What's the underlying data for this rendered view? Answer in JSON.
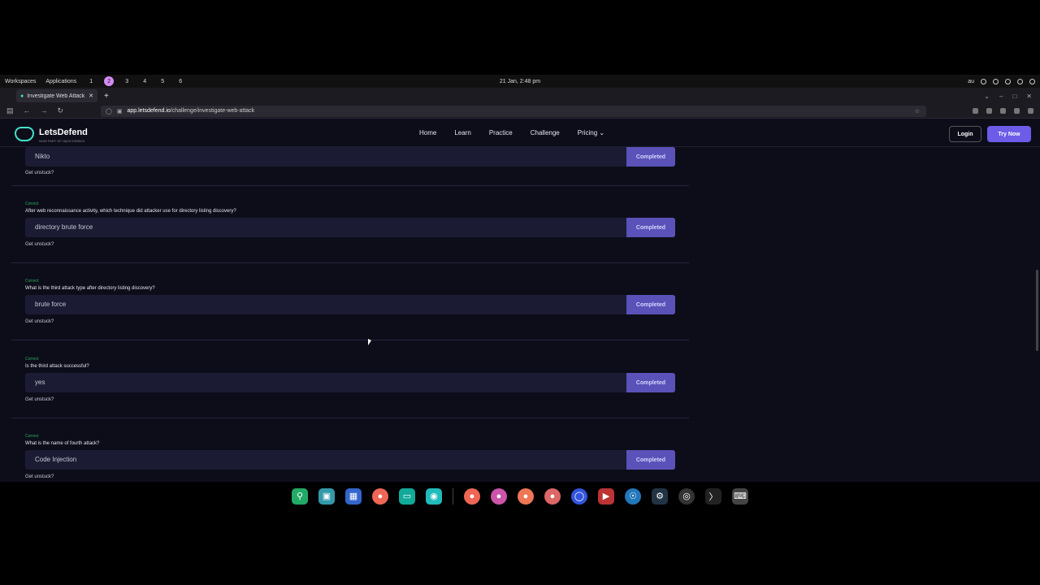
{
  "system_bar": {
    "workspaces_label": "Workspaces",
    "applications_label": "Applications",
    "workspace_numbers": [
      "1",
      "2",
      "3",
      "4",
      "5",
      "6"
    ],
    "active_workspace": "2",
    "clock": "21 Jan, 2:48 pm",
    "keyboard_layout": "au"
  },
  "browser": {
    "tab_title": "Investigate Web Attack - L",
    "url_host": "app.letsdefend.io",
    "url_path": "/challenge/investigate-web-attack"
  },
  "site": {
    "brand": "LetsDefend",
    "brand_sub": "NOW PART OF HACKTHEBOX",
    "brand_color": "#45e0c8",
    "nav": [
      "Home",
      "Learn",
      "Practice",
      "Challenge",
      "Pricing"
    ],
    "login_label": "Login",
    "try_label": "Try Now",
    "accent": "#6c5ce7"
  },
  "questions": [
    {
      "status": "",
      "question": "",
      "answer": "Nikto",
      "button": "Completed",
      "unstuck": "Get unstuck?"
    },
    {
      "status": "Correct",
      "question": "After web reconnaissance activity, which technique did attacker use for directory listing discovery?",
      "answer": "directory brute force",
      "button": "Completed",
      "unstuck": "Get unstuck?"
    },
    {
      "status": "Correct",
      "question": "What is the third attack type after directory listing discovery?",
      "answer": "brute force",
      "button": "Completed",
      "unstuck": "Get unstuck?"
    },
    {
      "status": "Correct",
      "question": "Is the third attack successful?",
      "answer": "yes",
      "button": "Completed",
      "unstuck": "Get unstuck?"
    },
    {
      "status": "Correct",
      "question": "What is the name of fourth attack?",
      "answer": "Code Injection",
      "button": "Completed",
      "unstuck": "Get unstuck?"
    }
  ],
  "dock_icons": [
    "search-icon",
    "window-icon",
    "app-grid-icon",
    "firefox-icon",
    "files-icon",
    "camera-icon",
    "firefox-icon",
    "firefox-icon",
    "firefox-icon",
    "firefox-icon",
    "signal-icon",
    "media-icon",
    "browser-icon",
    "steam-icon",
    "obs-icon",
    "terminal-icon",
    "keyboard-icon"
  ]
}
